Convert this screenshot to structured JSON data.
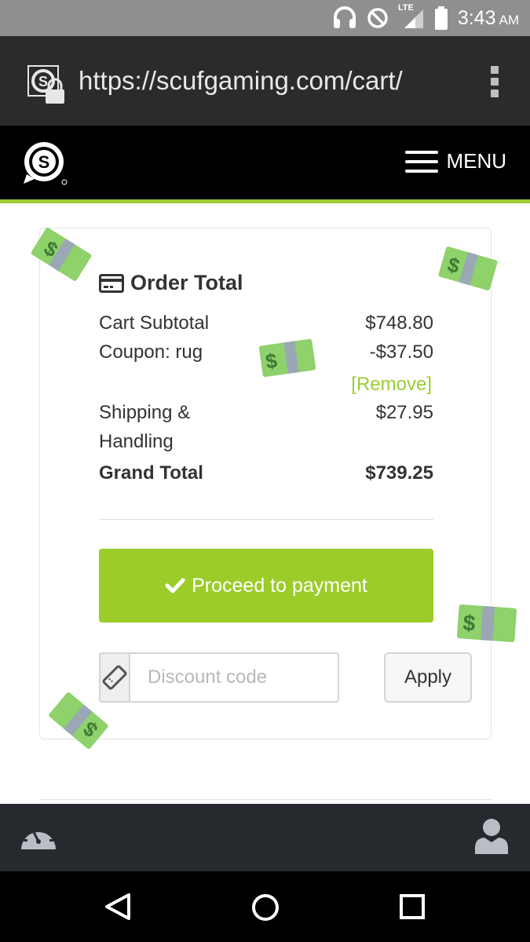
{
  "status_bar": {
    "time": "3:43",
    "ampm": "AM",
    "network_label": "LTE",
    "icons": [
      "headset-icon",
      "do-not-disturb-icon",
      "lte-signal-icon",
      "battery-icon"
    ]
  },
  "browser": {
    "url": "https://scufgaming.com/cart/",
    "icons": [
      "secure-site-icon",
      "overflow-menu-icon"
    ]
  },
  "site_header": {
    "logo_letter": "S",
    "menu_label": "MENU",
    "accent_color": "#9acd32"
  },
  "order_total": {
    "title": "Order Total",
    "cart_subtotal_label": "Cart Subtotal",
    "cart_subtotal_value": "$748.80",
    "coupon_label": "Coupon: rug",
    "coupon_value": "-$37.50",
    "remove_label": "[Remove]",
    "shipping_label_line1": "Shipping &",
    "shipping_label_line2": "Handling",
    "shipping_value": "$27.95",
    "grand_total_label": "Grand Total",
    "grand_total_value": "$739.25",
    "proceed_label": "Proceed to payment",
    "discount_placeholder": "Discount code",
    "apply_label": "Apply",
    "button_color": "#9ccc2a"
  },
  "app_bar": {
    "icons": [
      "dashboard-gauge-icon",
      "user-account-icon"
    ]
  },
  "nav_bar": {
    "icons": [
      "back-icon",
      "home-icon",
      "recent-apps-icon"
    ]
  },
  "decorations": {
    "emoji": "money-with-wings-icon"
  }
}
